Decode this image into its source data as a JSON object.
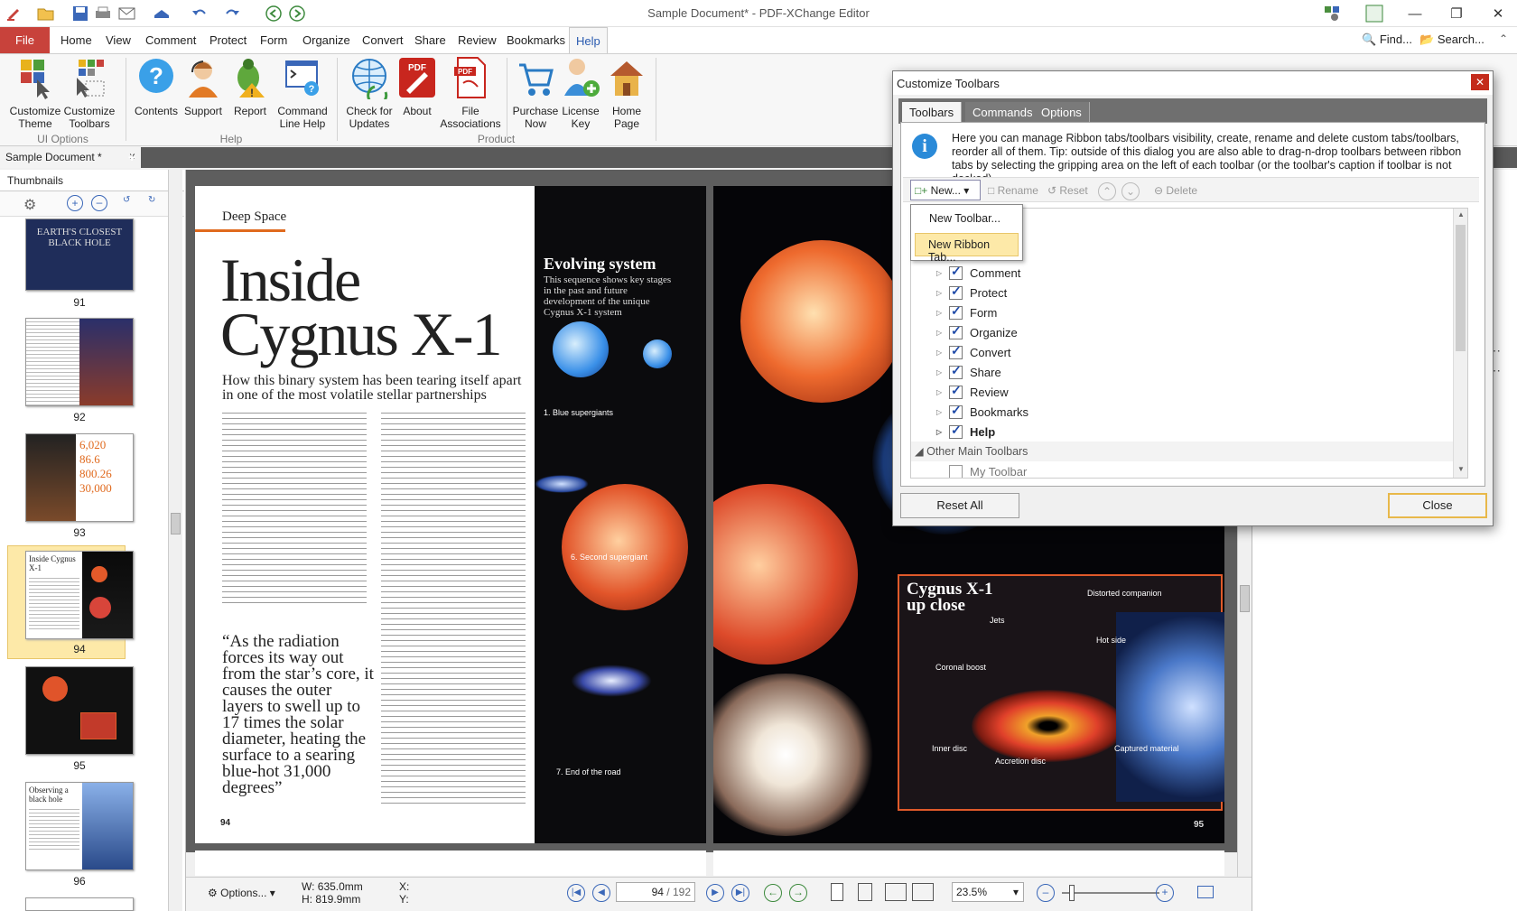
{
  "window": {
    "title": "Sample Document* - PDF-XChange Editor"
  },
  "menu": {
    "file": "File",
    "tabs": [
      "Home",
      "View",
      "Comment",
      "Protect",
      "Form",
      "Organize",
      "Convert",
      "Share",
      "Review",
      "Bookmarks",
      "Help"
    ],
    "active": "Help",
    "find": "Find...",
    "search": "Search..."
  },
  "ribbon": {
    "buttons": [
      {
        "l1": "Customize",
        "l2": "Theme",
        "icon": "palette-icon"
      },
      {
        "l1": "Customize",
        "l2": "Toolbars",
        "icon": "toolbar-icon"
      },
      {
        "l1": "Contents",
        "l2": "",
        "icon": "help-icon"
      },
      {
        "l1": "Support",
        "l2": "",
        "icon": "support-icon"
      },
      {
        "l1": "Report",
        "l2": "",
        "icon": "bug-icon"
      },
      {
        "l1": "Command",
        "l2": "Line Help",
        "icon": "command-line-icon"
      },
      {
        "l1": "Check for",
        "l2": "Updates",
        "icon": "globe-icon"
      },
      {
        "l1": "About",
        "l2": "",
        "icon": "pdf-icon"
      },
      {
        "l1": "File",
        "l2": "Associations",
        "icon": "file-assoc-icon"
      },
      {
        "l1": "Purchase",
        "l2": "Now",
        "icon": "cart-icon"
      },
      {
        "l1": "License",
        "l2": "Key",
        "icon": "user-add-icon"
      },
      {
        "l1": "Home",
        "l2": "Page",
        "icon": "home-icon"
      }
    ],
    "groups": [
      "UI Options",
      "Help",
      "Product"
    ]
  },
  "doc_tab": {
    "label": "Sample Document *"
  },
  "thumbnails": {
    "title": "Thumbnails",
    "pages": [
      "91",
      "92",
      "93",
      "94",
      "95",
      "96"
    ],
    "selected": "94"
  },
  "page_left": {
    "section": "Deep Space",
    "title1": "Inside",
    "title2": "Cygnus X-1",
    "subtitle": "How this binary system has been tearing itself apart in one of the most volatile stellar partnerships",
    "quote": "“As the radiation forces its way out from the star’s core, it causes the outer layers to swell up to 17 times the solar diameter, heating the surface to a searing blue-hot 31,000 degrees”",
    "page_no": "94",
    "panel_title": "Evolving system",
    "panel_sub": "This sequence shows key stages in the past and future development of the unique Cygnus X-1 system",
    "cap1": "1. Blue supergiants",
    "cap6": "6. Second supergiant",
    "cap7": "7. End of the road"
  },
  "page_right": {
    "box_title1": "Cygnus X-1",
    "box_title2": "up close",
    "labels": [
      "Jets",
      "Coronal boost",
      "Inner disc",
      "Accretion disc",
      "Distorted companion",
      "Hot side",
      "Captured material"
    ],
    "page_no": "95"
  },
  "status": {
    "options": "Options...",
    "w": "W: 635.0mm",
    "h": "H: 819.9mm",
    "x": "X:",
    "y": "Y:",
    "page_value": "94",
    "page_total": "/ 192",
    "zoom": "23.5%"
  },
  "dialog": {
    "title": "Customize Toolbars",
    "tabs": [
      "Toolbars",
      "Commands",
      "Options"
    ],
    "info": "Here you can manage Ribbon tabs/toolbars visibility, create, rename and delete custom tabs/toolbars, reorder all of them. Tip: outside of this dialog you are also able to drag-n-drop toolbars between ribbon tabs by selecting the gripping area on the left of each toolbar (or the toolbar's caption if toolbar is not docked).",
    "new": "New...",
    "rename": "Rename",
    "reset": "Reset",
    "delete": "Delete",
    "menu": [
      "New Toolbar...",
      "New Ribbon Tab..."
    ],
    "tree": [
      "Comment",
      "Protect",
      "Form",
      "Organize",
      "Convert",
      "Share",
      "Review",
      "Bookmarks",
      "Help"
    ],
    "group2": "Other Main Toolbars",
    "partial": "My Toolbar",
    "reset_all": "Reset All",
    "close": "Close"
  },
  "colors": {
    "file_tab": "#c8423b",
    "accent": "#2a5bb0",
    "highlight": "#fde9a8"
  }
}
